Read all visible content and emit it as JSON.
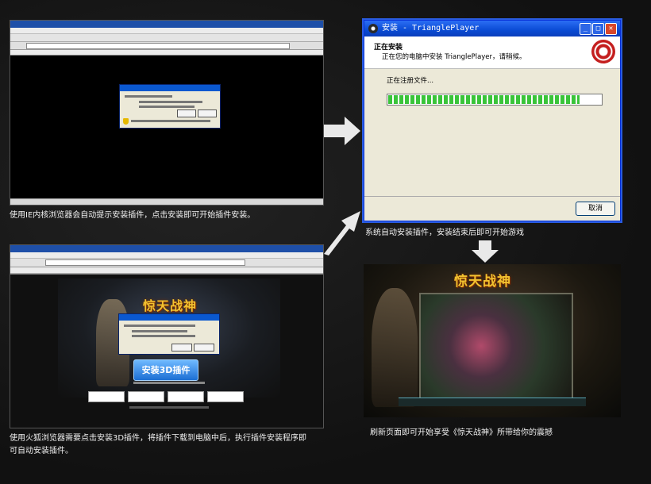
{
  "install_window": {
    "title": "安装 - TrianglePlayer",
    "header_title": "正在安装",
    "header_subtitle": "正在您的电脑中安装 TrianglePlayer，请稍候。",
    "status_label": "正在注册文件...",
    "progress": 0.9,
    "cancel_label": "取消",
    "btn_min": "_",
    "btn_max": "□",
    "btn_close": "✕"
  },
  "captions": {
    "ie": "使用IE内核浏览器会自动提示安装插件，点击安装即可开始插件安装。",
    "auto_install": "系统自动安装插件，安装结束后即可开始游戏",
    "firefox_line1": "使用火狐浏览器需要点击安装3D插件，将插件下载到电脑中后，执行插件安装程序即",
    "firefox_line2": "可自动安装插件。",
    "game": "刷新页面即可开始享受《惊天战神》所带给你的震撼"
  },
  "firefox_page": {
    "banner": "惊天战神",
    "install_button": "安装3D插件"
  },
  "game_shot": {
    "banner": "惊天战神"
  },
  "colors": {
    "progress_green": "#3ac43a",
    "title_blue": "#0a4bd4",
    "banner_gold": "#f2c230"
  }
}
